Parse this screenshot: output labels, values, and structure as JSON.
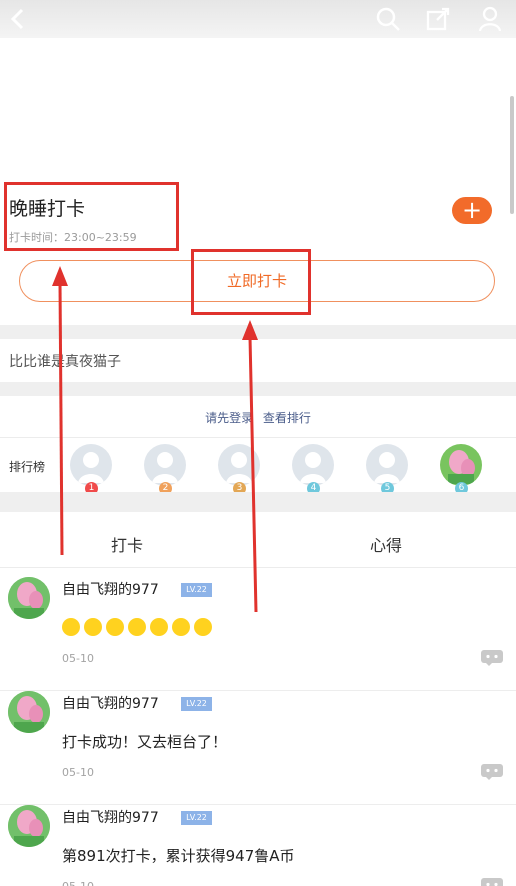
{
  "header": {
    "back": "back-icon",
    "search": "search-icon",
    "share": "share-icon",
    "user": "user-icon"
  },
  "checkin": {
    "title": "晚睡打卡",
    "time_label": "打卡时间：23:00~23:59",
    "button_label": "立即打卡"
  },
  "description": "比比谁是真夜猫子",
  "ranking": {
    "login_text": "请先登录",
    "view_text": "查看排行",
    "label": "排行榜",
    "slots": [
      {
        "rank": "1",
        "color": "#f04b4b"
      },
      {
        "rank": "2",
        "color": "#f0a15b"
      },
      {
        "rank": "3",
        "color": "#e3a755"
      },
      {
        "rank": "4",
        "color": "#6fc8dc"
      },
      {
        "rank": "5",
        "color": "#6fc8dc"
      },
      {
        "rank": "6",
        "color": "#6fc8dc"
      }
    ]
  },
  "tabs": {
    "checkin": "打卡",
    "notes": "心得"
  },
  "posts": [
    {
      "username": "自由飞翔的977",
      "level": "LV.22",
      "content": "",
      "date": "05-10"
    },
    {
      "username": "自由飞翔的977",
      "level": "LV.22",
      "content": "打卡成功！又去桓台了！",
      "date": "05-10"
    },
    {
      "username": "自由飞翔的977",
      "level": "LV.22",
      "content": "第891次打卡，累计获得947鲁A币",
      "date": "05-10"
    }
  ],
  "colors": {
    "accent": "#f26b2a",
    "annotation": "#e0322d",
    "level_badge": "#8db3e8"
  }
}
